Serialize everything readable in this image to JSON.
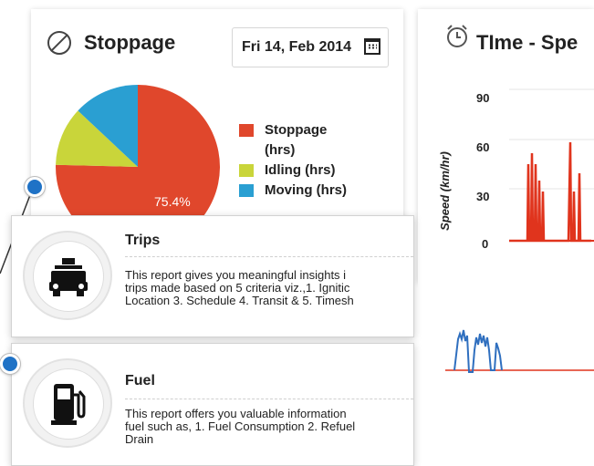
{
  "stoppage": {
    "title": "Stoppage",
    "date": "Fri 14, Feb 2014",
    "pie_label": "75.4%",
    "legend": [
      {
        "label_line1": "Stoppage",
        "label_line2": "(hrs)",
        "color": "#e0472c"
      },
      {
        "label_line1": "Idling (hrs)",
        "label_line2": "",
        "color": "#c9d53a"
      },
      {
        "label_line1": "Moving (hrs)",
        "label_line2": "",
        "color": "#2a9fd2"
      }
    ]
  },
  "chart_data": {
    "type": "pie",
    "categories": [
      "Stoppage (hrs)",
      "Idling (hrs)",
      "Moving (hrs)"
    ],
    "values": [
      75.4,
      11.6,
      13.0
    ]
  },
  "speed": {
    "title": "TIme - Spe",
    "ylabel": "Speed (km/hr)",
    "yticks": [
      "90",
      "60",
      "30",
      "0"
    ],
    "colors": {
      "line": "#e0341d",
      "lower_line": "#2f6fbf"
    }
  },
  "cards": [
    {
      "title": "Trips",
      "icon": "car-icon",
      "desc": [
        "This report gives you meaningful insights i",
        "trips made based on 5 criteria viz.,1. Ignitic",
        "Location 3. Schedule 4. Transit & 5. Timesh"
      ]
    },
    {
      "title": "Fuel",
      "icon": "fuel-pump-icon",
      "desc": [
        "This report offers you valuable information",
        "fuel such as, 1. Fuel Consumption 2. Refuel",
        "Drain"
      ]
    }
  ]
}
